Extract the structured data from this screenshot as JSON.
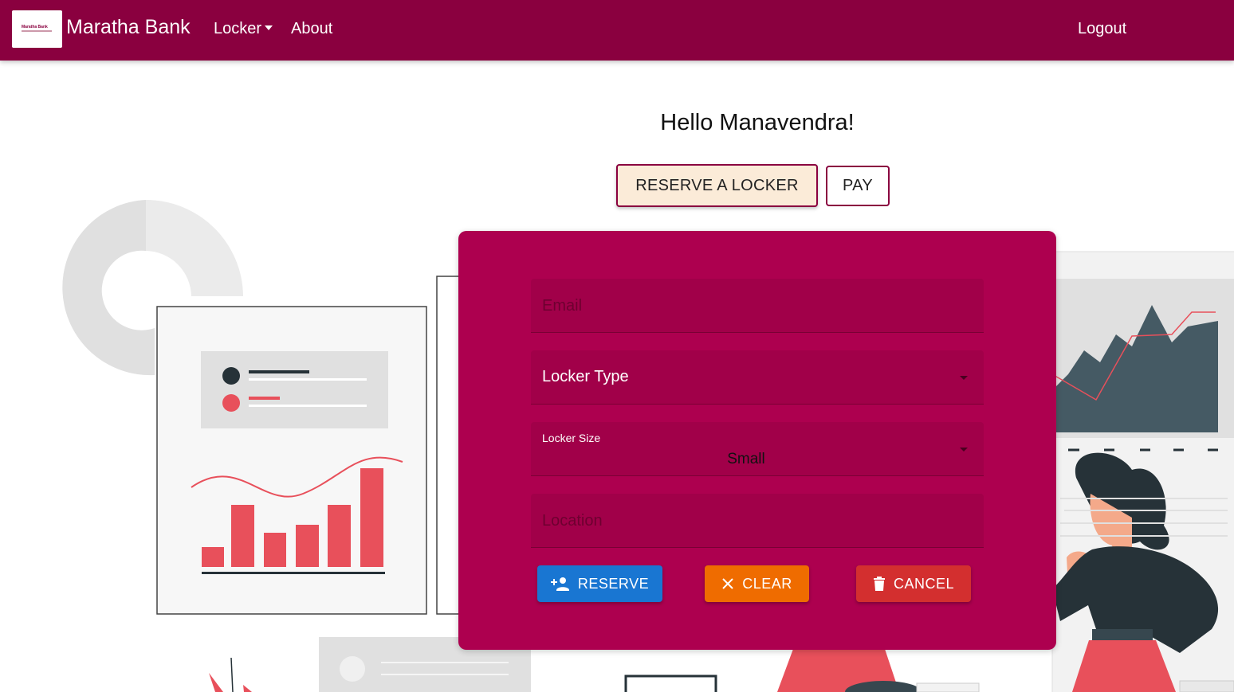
{
  "navbar": {
    "logo_text": "Maratha Bank",
    "brand": "Maratha Bank",
    "locker_menu": "Locker",
    "about_link": "About",
    "logout_link": "Logout",
    "color": "#8a003f"
  },
  "main": {
    "greeting": "Hello Manavendra!",
    "reserve_locker_button": "RESERVE A LOCKER",
    "pay_button": "PAY"
  },
  "form": {
    "card_color": "#ad004f",
    "email_placeholder": "Email",
    "locker_type_label": "Locker Type",
    "locker_size_label": "Locker Size",
    "locker_size_value": "Small",
    "location_placeholder": "Location",
    "reserve_button": "RESERVE",
    "clear_button": "CLEAR",
    "cancel_button": "CANCEL"
  },
  "icons": [
    "person-add-icon",
    "close-icon",
    "trash-icon",
    "dropdown-arrow-icon",
    "caret-down-icon"
  ]
}
